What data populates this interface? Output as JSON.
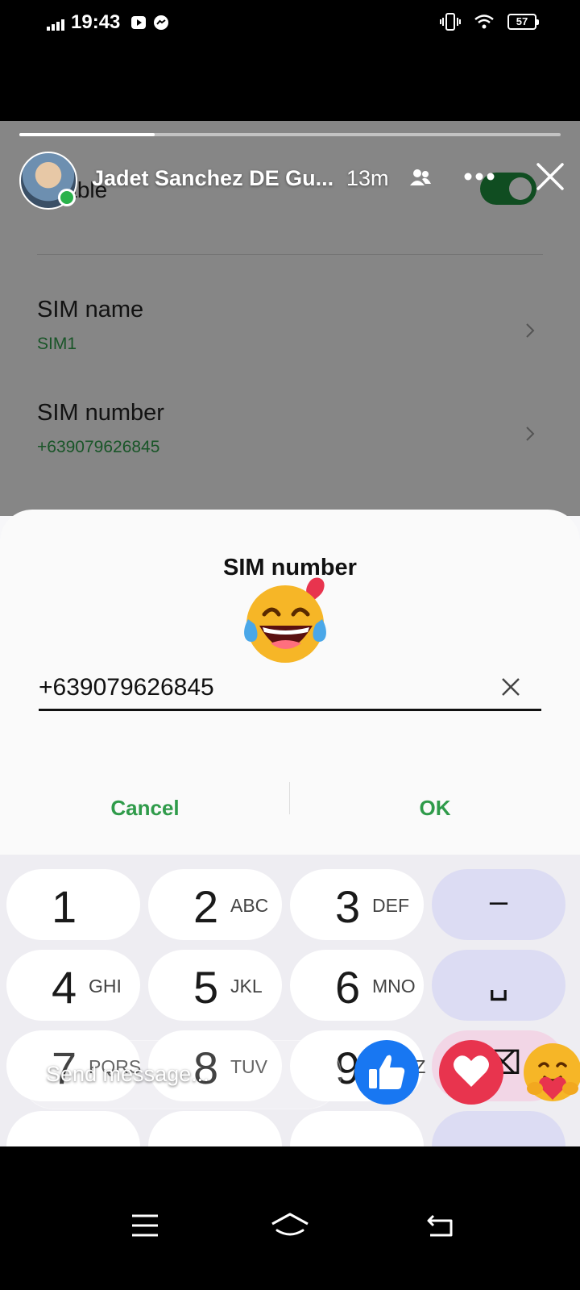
{
  "status_bar": {
    "time": "19:43",
    "battery": "57",
    "icons": [
      "signal-icon",
      "youtube-icon",
      "messenger-icon",
      "vibrate-icon",
      "wifi-icon",
      "battery-icon"
    ]
  },
  "settings_background": {
    "enable_label": "Enable",
    "sim_name": {
      "title": "SIM name",
      "value": "SIM1"
    },
    "sim_number": {
      "title": "SIM number",
      "value": "+639079626845"
    }
  },
  "dialog": {
    "title": "SIM number",
    "input_value": "+639079626845",
    "cancel_label": "Cancel",
    "ok_label": "OK"
  },
  "keypad": {
    "keys": [
      {
        "num": "1",
        "letters": ""
      },
      {
        "num": "2",
        "letters": "ABC"
      },
      {
        "num": "3",
        "letters": "DEF"
      },
      {
        "num": "–",
        "letters": ""
      },
      {
        "num": "4",
        "letters": "GHI"
      },
      {
        "num": "5",
        "letters": "JKL"
      },
      {
        "num": "6",
        "letters": "MNO"
      },
      {
        "num": "␣",
        "letters": ""
      },
      {
        "num": "7",
        "letters": "PQRS"
      },
      {
        "num": "8",
        "letters": "TUV"
      },
      {
        "num": "9",
        "letters": "WXYZ"
      },
      {
        "num": "⌫",
        "letters": ""
      }
    ]
  },
  "story": {
    "progress": 0.25,
    "user_name": "Jadet Sanchez DE Gu...",
    "time_ago": "13m",
    "reply_placeholder": "Send message...",
    "colors": {
      "like": "#1877f2",
      "love": "#e8344e",
      "accent_green": "#2f9b4a"
    }
  }
}
